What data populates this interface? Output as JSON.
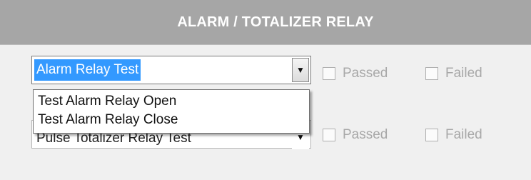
{
  "panel": {
    "title": "ALARM / TOTALIZER RELAY"
  },
  "alarm_relay": {
    "selected": "Alarm Relay Test",
    "options": [
      "Test Alarm Relay Open",
      "Test Alarm Relay Close"
    ],
    "passed_label": "Passed",
    "failed_label": "Failed"
  },
  "pulse_totalizer": {
    "selected": "Pulse Totalizer Relay Test",
    "passed_label": "Passed",
    "failed_label": "Failed"
  },
  "icons": {
    "dropdown_arrow": "chevron-down-icon"
  }
}
